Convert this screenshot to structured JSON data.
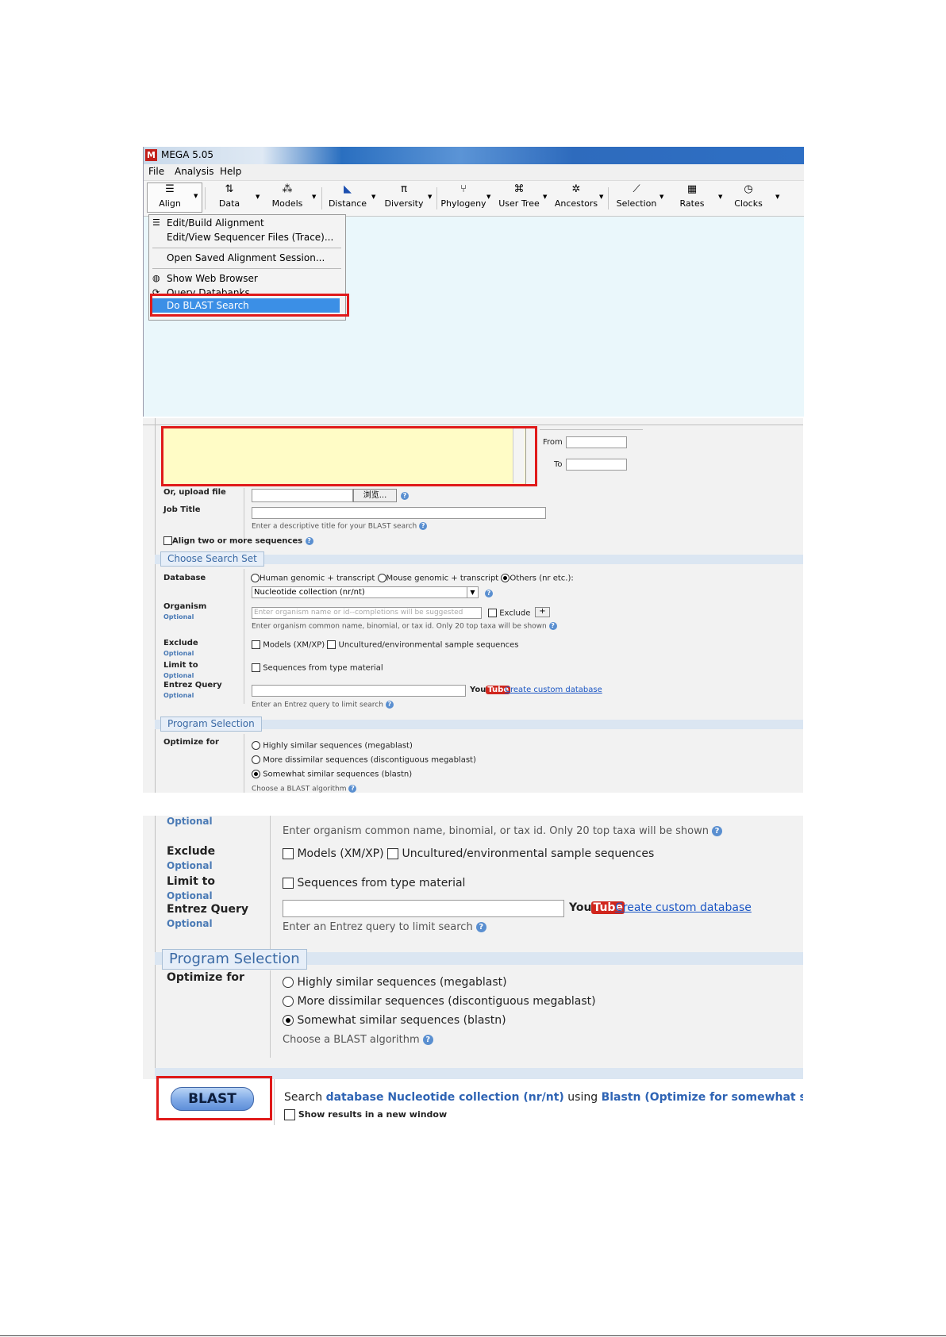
{
  "mega": {
    "title": "MEGA 5.05",
    "logo": "M",
    "menu": [
      "File",
      "Analysis",
      "Help"
    ],
    "toolbar": [
      {
        "label": "Align",
        "icon": "align-icon"
      },
      {
        "label": "Data",
        "icon": "data-icon"
      },
      {
        "label": "Models",
        "icon": "models-icon"
      },
      {
        "label": "Distance",
        "icon": "distance-icon"
      },
      {
        "label": "Diversity",
        "icon": "diversity-icon"
      },
      {
        "label": "Phylogeny",
        "icon": "phylogeny-icon"
      },
      {
        "label": "User Tree",
        "icon": "user-tree-icon"
      },
      {
        "label": "Ancestors",
        "icon": "ancestors-icon"
      },
      {
        "label": "Selection",
        "icon": "selection-icon"
      },
      {
        "label": "Rates",
        "icon": "rates-icon"
      },
      {
        "label": "Clocks",
        "icon": "clocks-icon"
      }
    ],
    "align_menu": [
      "Edit/Build Alignment",
      "Edit/View Sequencer Files (Trace)...",
      "Open Saved Alignment Session...",
      "Show Web Browser",
      "Query Databanks",
      "Do BLAST Search"
    ],
    "highlighted_item": "Do BLAST Search"
  },
  "form1": {
    "from_label": "From",
    "to_label": "To",
    "upload_label": "Or, upload file",
    "browse_button": "浏览...",
    "job_title_label": "Job Title",
    "job_title_hint": "Enter a descriptive title for your BLAST search",
    "align_two": "Align two or more sequences",
    "choose_search_set": "Choose Search Set",
    "database_label": "Database",
    "db_options": [
      "Human genomic + transcript",
      "Mouse genomic + transcript",
      "Others (nr etc.):"
    ],
    "db_select": "Nucleotide collection (nr/nt)",
    "organism_label": "Organism",
    "optional": "Optional",
    "organism_placeholder": "Enter organism name or id--completions will be suggested",
    "exclude_checkbox": "Exclude",
    "organism_hint": "Enter organism common name, binomial, or tax id. Only 20 top taxa will be shown",
    "exclude_label": "Exclude",
    "exclude_models": "Models (XM/XP)",
    "exclude_uncultured": "Uncultured/environmental sample sequences",
    "limit_label": "Limit to",
    "limit_option": "Sequences from type material",
    "entrez_label": "Entrez Query",
    "youtube_you": "You",
    "youtube_tube": "Tube",
    "custom_db_link": "Create custom database",
    "entrez_hint": "Enter an Entrez query to limit search",
    "program_selection": "Program Selection",
    "optimize_label": "Optimize for",
    "programs": [
      "Highly similar sequences (megablast)",
      "More dissimilar sequences (discontiguous megablast)",
      "Somewhat similar sequences (blastn)"
    ],
    "choose_algorithm": "Choose a BLAST algorithm"
  },
  "form2": {
    "optional": "Optional",
    "organism_hint": "Enter organism common name, binomial, or tax id. Only 20 top taxa will be shown",
    "exclude_label": "Exclude",
    "exclude_models": "Models (XM/XP)",
    "exclude_uncultured": "Uncultured/environmental sample sequences",
    "limit_label": "Limit to",
    "limit_option": "Sequences from type material",
    "entrez_label": "Entrez Query",
    "youtube_you": "You",
    "youtube_tube": "Tube",
    "custom_db_link": "Create custom database",
    "entrez_hint": "Enter an Entrez query to limit search",
    "program_selection": "Program Selection",
    "optimize_label": "Optimize for",
    "programs": [
      "Highly similar sequences (megablast)",
      "More dissimilar sequences (discontiguous megablast)",
      "Somewhat similar sequences (blastn)"
    ],
    "choose_algorithm": "Choose a BLAST algorithm",
    "blast_button": "BLAST",
    "search_prefix": "Search",
    "search_db": "database Nucleotide collection (nr/nt)",
    "search_using": "using",
    "search_program": "Blastn (Optimize for somewhat similar seque",
    "new_window": "Show results in a new window"
  },
  "colors": {
    "highlight": "#3b8fe6",
    "redbox": "#e01a1a",
    "query_box": "#fffcc6",
    "link": "#1a55c4"
  }
}
